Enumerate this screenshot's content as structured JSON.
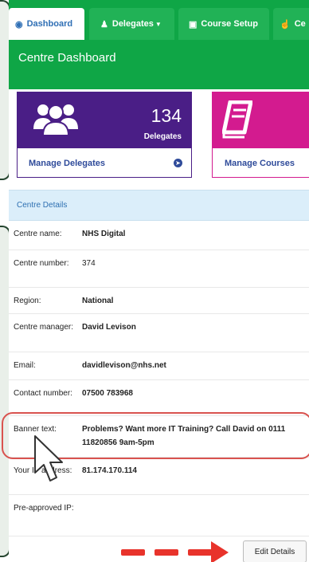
{
  "nav": {
    "tabs": [
      {
        "label": "Dashboard",
        "icon": "dashboard-icon",
        "active": true
      },
      {
        "label": "Delegates",
        "icon": "user-icon",
        "active": false
      },
      {
        "label": "Course Setup",
        "icon": "book-icon",
        "active": false
      },
      {
        "label": "Ce",
        "icon": "thumbs-up-icon",
        "active": false
      }
    ],
    "title": "Centre Dashboard"
  },
  "tiles": {
    "delegates": {
      "count": "134",
      "caption": "Delegates",
      "link": "Manage Delegates",
      "color": "#4a1e86"
    },
    "courses": {
      "link": "Manage Courses",
      "color": "#d31b8f"
    }
  },
  "details": {
    "heading": "Centre Details",
    "rows": [
      {
        "label": "Centre name:",
        "value": "NHS Digital"
      },
      {
        "label": "Centre number:",
        "value": "374"
      },
      {
        "label": "Region:",
        "value": "National"
      },
      {
        "label": "Centre manager:",
        "value": "David Levison"
      },
      {
        "label": "Email:",
        "value": "davidlevison@nhs.net"
      },
      {
        "label": "Contact number:",
        "value": "07500 783968"
      },
      {
        "label": "Banner text:",
        "value": "Problems? Want more IT Training? Call David on 0111 11820856 9am-5pm"
      },
      {
        "label": "Your IP address:",
        "value": "81.174.170.114"
      },
      {
        "label": "Pre-approved IP:",
        "value": ""
      }
    ]
  },
  "actions": {
    "edit_label": "Edit Details"
  },
  "colors": {
    "nav_green": "#0fa646",
    "link_blue": "#2f4b9a",
    "highlight_red": "#d9534f"
  }
}
